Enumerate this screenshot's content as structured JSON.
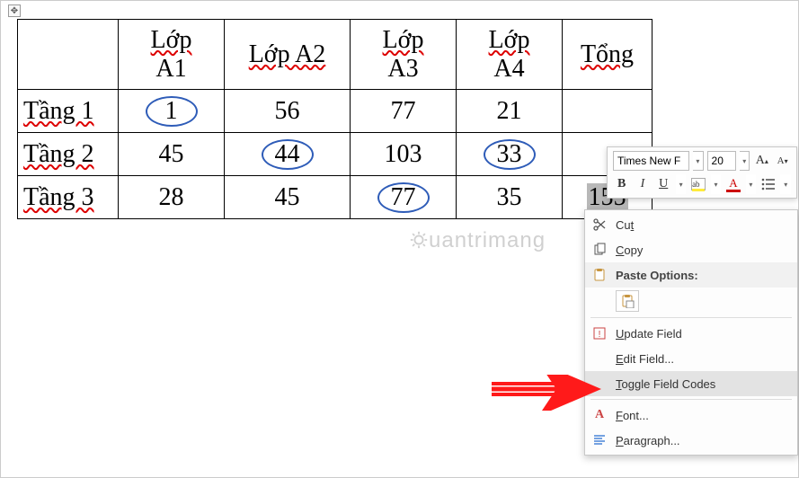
{
  "table": {
    "headers": [
      "",
      "Lớp A1",
      "Lớp A2",
      "Lớp A3",
      "Lớp A4",
      "Tổng"
    ],
    "header_line1": [
      "",
      "Lớp",
      "Lớp A2",
      "Lớp",
      "Lớp",
      "Tổng"
    ],
    "header_line2": [
      "",
      "A1",
      "",
      "A3",
      "A4",
      ""
    ],
    "rows": [
      {
        "label": "Tầng 1",
        "cells": [
          "1",
          "56",
          "77",
          "21",
          ""
        ],
        "circled": [
          0
        ]
      },
      {
        "label": "Tầng 2",
        "cells": [
          "45",
          "44",
          "103",
          "33",
          ""
        ],
        "circled": [
          1,
          3
        ]
      },
      {
        "label": "Tầng 3",
        "cells": [
          "28",
          "45",
          "77",
          "35",
          "155"
        ],
        "circled": [
          2
        ],
        "selected_col": 4
      }
    ]
  },
  "mini_toolbar": {
    "font_name": "Times New F",
    "font_size": "20",
    "grow_label": "A",
    "shrink_label": "A",
    "bold": "B",
    "italic": "I",
    "underline": "U",
    "highlight_letter": "ab",
    "fontcolor_letter": "A"
  },
  "context_menu": {
    "cut": {
      "label": "Cut",
      "accel_index": 2
    },
    "copy": {
      "label": "Copy",
      "accel_index": 0
    },
    "paste_header": "Paste Options:",
    "update_field": "Update Field",
    "edit_field": "Edit Field...",
    "toggle_field_codes": "Toggle Field Codes",
    "font": "Font...",
    "paragraph": "Paragraph..."
  },
  "watermark": "uantrimang"
}
